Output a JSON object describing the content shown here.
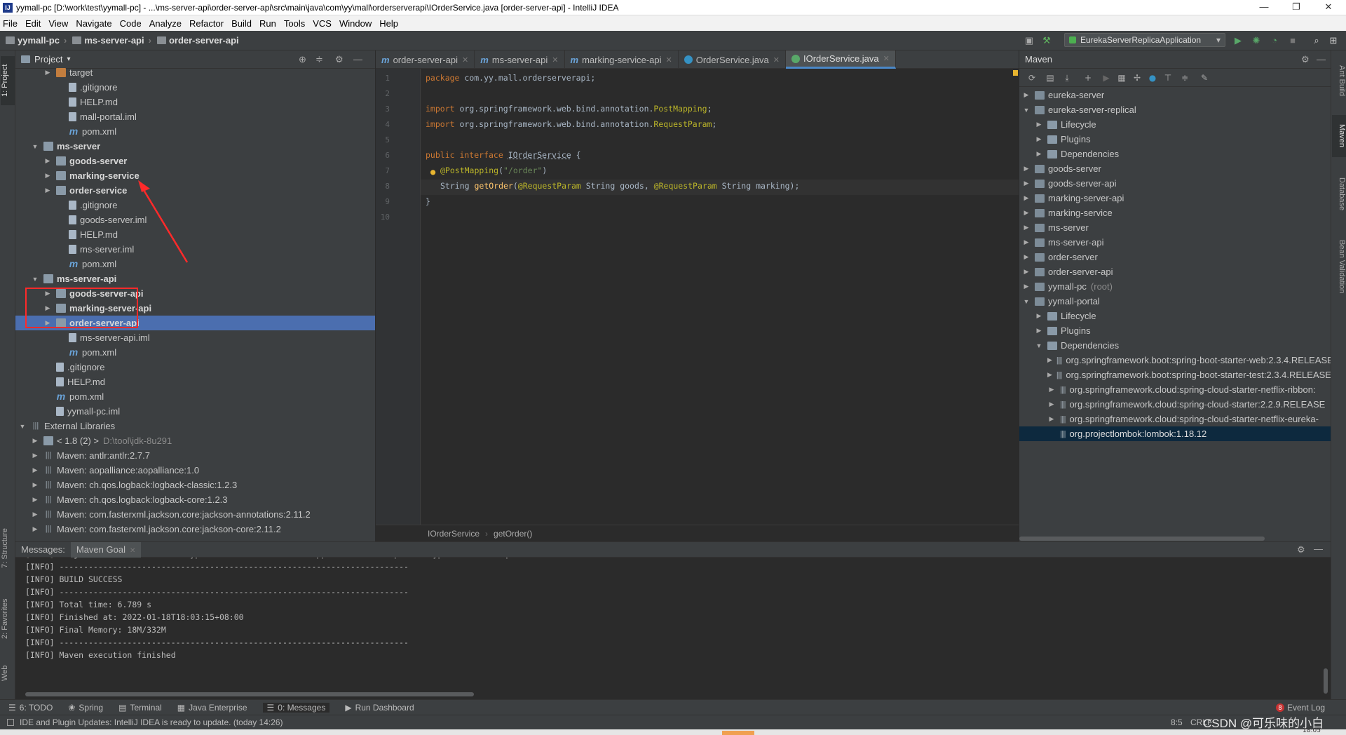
{
  "window": {
    "title": "yymall-pc [D:\\work\\test\\yymall-pc] - ...\\ms-server-api\\order-server-api\\src\\main\\java\\com\\yy\\mall\\orderserverapi\\IOrderService.java [order-server-api] - IntelliJ IDEA",
    "minimize": "—",
    "maximize": "❐",
    "close": "✕"
  },
  "menu": [
    "File",
    "Edit",
    "View",
    "Navigate",
    "Code",
    "Analyze",
    "Refactor",
    "Build",
    "Run",
    "Tools",
    "VCS",
    "Window",
    "Help"
  ],
  "breadcrumb": [
    "yymall-pc",
    "ms-server-api",
    "order-server-api"
  ],
  "run_config": "EurekaServerReplicaApplication",
  "left_strip": {
    "project": "1: Project",
    "structure": "7: Structure",
    "favorites": "2: Favorites",
    "web": "Web"
  },
  "right_strip": {
    "ant": "Ant Build",
    "maven": "Maven",
    "database": "Database",
    "bean": "Bean Validation"
  },
  "project_panel": {
    "title": "Project",
    "dropdown": "▾",
    "tree": [
      {
        "label": "target",
        "kind": "folder-orange",
        "depth": 2,
        "arrow": "▶"
      },
      {
        "label": ".gitignore",
        "kind": "file",
        "depth": 3,
        "arrow": ""
      },
      {
        "label": "HELP.md",
        "kind": "file",
        "depth": 3,
        "arrow": ""
      },
      {
        "label": "mall-portal.iml",
        "kind": "file",
        "depth": 3,
        "arrow": ""
      },
      {
        "label": "pom.xml",
        "kind": "xml",
        "depth": 3,
        "arrow": ""
      },
      {
        "label": "ms-server",
        "kind": "folder",
        "depth": 1,
        "arrow": "▼",
        "bold": true
      },
      {
        "label": "goods-server",
        "kind": "folder",
        "depth": 2,
        "arrow": "▶",
        "bold": true
      },
      {
        "label": "marking-service",
        "kind": "folder",
        "depth": 2,
        "arrow": "▶",
        "bold": true
      },
      {
        "label": "order-service",
        "kind": "folder",
        "depth": 2,
        "arrow": "▶",
        "bold": true
      },
      {
        "label": ".gitignore",
        "kind": "file",
        "depth": 3,
        "arrow": ""
      },
      {
        "label": "goods-server.iml",
        "kind": "file",
        "depth": 3,
        "arrow": ""
      },
      {
        "label": "HELP.md",
        "kind": "file",
        "depth": 3,
        "arrow": ""
      },
      {
        "label": "ms-server.iml",
        "kind": "file",
        "depth": 3,
        "arrow": ""
      },
      {
        "label": "pom.xml",
        "kind": "xml",
        "depth": 3,
        "arrow": ""
      },
      {
        "label": "ms-server-api",
        "kind": "folder",
        "depth": 1,
        "arrow": "▼",
        "bold": true
      },
      {
        "label": "goods-server-api",
        "kind": "folder",
        "depth": 2,
        "arrow": "▶",
        "bold": true
      },
      {
        "label": "marking-server-api",
        "kind": "folder",
        "depth": 2,
        "arrow": "▶",
        "bold": true
      },
      {
        "label": "order-server-api",
        "kind": "folder",
        "depth": 2,
        "arrow": "▶",
        "bold": true,
        "selected": true
      },
      {
        "label": "ms-server-api.iml",
        "kind": "file",
        "depth": 3,
        "arrow": ""
      },
      {
        "label": "pom.xml",
        "kind": "xml",
        "depth": 3,
        "arrow": ""
      },
      {
        "label": ".gitignore",
        "kind": "file",
        "depth": 2,
        "arrow": ""
      },
      {
        "label": "HELP.md",
        "kind": "file",
        "depth": 2,
        "arrow": ""
      },
      {
        "label": "pom.xml",
        "kind": "xml",
        "depth": 2,
        "arrow": ""
      },
      {
        "label": "yymall-pc.iml",
        "kind": "file",
        "depth": 2,
        "arrow": ""
      },
      {
        "label": "External Libraries",
        "kind": "lib",
        "depth": 0,
        "arrow": "▼"
      },
      {
        "label": "< 1.8 (2) >",
        "kind": "folder",
        "depth": 1,
        "arrow": "▶",
        "extra": "D:\\tool\\jdk-8u291"
      },
      {
        "label": "Maven: antlr:antlr:2.7.7",
        "kind": "lib",
        "depth": 1,
        "arrow": "▶"
      },
      {
        "label": "Maven: aopalliance:aopalliance:1.0",
        "kind": "lib",
        "depth": 1,
        "arrow": "▶"
      },
      {
        "label": "Maven: ch.qos.logback:logback-classic:1.2.3",
        "kind": "lib",
        "depth": 1,
        "arrow": "▶"
      },
      {
        "label": "Maven: ch.qos.logback:logback-core:1.2.3",
        "kind": "lib",
        "depth": 1,
        "arrow": "▶"
      },
      {
        "label": "Maven: com.fasterxml.jackson.core:jackson-annotations:2.11.2",
        "kind": "lib",
        "depth": 1,
        "arrow": "▶"
      },
      {
        "label": "Maven: com.fasterxml.jackson.core:jackson-core:2.11.2",
        "kind": "lib",
        "depth": 1,
        "arrow": "▶"
      }
    ]
  },
  "editor_tabs": [
    {
      "label": "order-server-api",
      "icon": "m"
    },
    {
      "label": "ms-server-api",
      "icon": "m"
    },
    {
      "label": "marking-service-api",
      "icon": "m"
    },
    {
      "label": "OrderService.java",
      "icon": "class"
    },
    {
      "label": "IOrderService.java",
      "icon": "interface",
      "active": true
    }
  ],
  "code": {
    "line_numbers": [
      "1",
      "2",
      "3",
      "4",
      "5",
      "6",
      "7",
      "8",
      "9",
      "10"
    ],
    "l1_kw": "package",
    "l1_rest": " com.yy.mall.orderserverapi;",
    "l3_kw": "import",
    "l3_pre": " org.springframework.web.bind.annotation.",
    "l3_ann": "PostMapping",
    "l3_end": ";",
    "l4_kw": "import",
    "l4_pre": " org.springframework.web.bind.annotation.",
    "l4_ann": "RequestParam",
    "l4_end": ";",
    "l6_kw": "public interface ",
    "l6_name": "IOrderService",
    "l6_end": " {",
    "l7_ann": "@PostMapping",
    "l7_p1": "(",
    "l7_str": "\"/order\"",
    "l7_p2": ")",
    "l8_t1": "String ",
    "l8_fn": "getOrder",
    "l8_a": "(",
    "l8_ann1": "@RequestParam",
    "l8_b": " String goods, ",
    "l8_ann2": "@RequestParam",
    "l8_c": " String marking);",
    "l9": "}"
  },
  "editor_breadcrumb": [
    "IOrderService",
    "getOrder()"
  ],
  "maven_panel": {
    "title": "Maven",
    "tree": [
      {
        "label": "eureka-server",
        "depth": 0,
        "arrow": "▶",
        "icon": "module"
      },
      {
        "label": "eureka-server-replical",
        "depth": 0,
        "arrow": "▼",
        "icon": "module"
      },
      {
        "label": "Lifecycle",
        "depth": 1,
        "arrow": "▶",
        "icon": "folder"
      },
      {
        "label": "Plugins",
        "depth": 1,
        "arrow": "▶",
        "icon": "folder"
      },
      {
        "label": "Dependencies",
        "depth": 1,
        "arrow": "▶",
        "icon": "folder"
      },
      {
        "label": "goods-server",
        "depth": 0,
        "arrow": "▶",
        "icon": "module"
      },
      {
        "label": "goods-server-api",
        "depth": 0,
        "arrow": "▶",
        "icon": "module"
      },
      {
        "label": "marking-server-api",
        "depth": 0,
        "arrow": "▶",
        "icon": "module"
      },
      {
        "label": "marking-service",
        "depth": 0,
        "arrow": "▶",
        "icon": "module"
      },
      {
        "label": "ms-server",
        "depth": 0,
        "arrow": "▶",
        "icon": "module"
      },
      {
        "label": "ms-server-api",
        "depth": 0,
        "arrow": "▶",
        "icon": "module"
      },
      {
        "label": "order-server",
        "depth": 0,
        "arrow": "▶",
        "icon": "module"
      },
      {
        "label": "order-server-api",
        "depth": 0,
        "arrow": "▶",
        "icon": "module"
      },
      {
        "label": "yymall-pc",
        "depth": 0,
        "arrow": "▶",
        "icon": "module",
        "extra": "(root)"
      },
      {
        "label": "yymall-portal",
        "depth": 0,
        "arrow": "▼",
        "icon": "module"
      },
      {
        "label": "Lifecycle",
        "depth": 1,
        "arrow": "▶",
        "icon": "folder"
      },
      {
        "label": "Plugins",
        "depth": 1,
        "arrow": "▶",
        "icon": "folder"
      },
      {
        "label": "Dependencies",
        "depth": 1,
        "arrow": "▼",
        "icon": "folder"
      },
      {
        "label": "org.springframework.boot:spring-boot-starter-web:2.3.4.RELEASE",
        "depth": 2,
        "arrow": "▶",
        "icon": "dep"
      },
      {
        "label": "org.springframework.boot:spring-boot-starter-test:2.3.4.RELEASE",
        "depth": 2,
        "arrow": "▶",
        "icon": "dep"
      },
      {
        "label": "org.springframework.cloud:spring-cloud-starter-netflix-ribbon:",
        "depth": 2,
        "arrow": "▶",
        "icon": "dep"
      },
      {
        "label": "org.springframework.cloud:spring-cloud-starter:2.2.9.RELEASE",
        "depth": 2,
        "arrow": "▶",
        "icon": "dep"
      },
      {
        "label": "org.springframework.cloud:spring-cloud-starter-netflix-eureka-",
        "depth": 2,
        "arrow": "▶",
        "icon": "dep"
      },
      {
        "label": "org.projectlombok:lombok:1.18.12",
        "depth": 2,
        "arrow": "",
        "icon": "dep",
        "selected": true
      }
    ]
  },
  "bottom_panel": {
    "tab_messages": "Messages:",
    "tab_goal": "Maven Goal",
    "lines": [
      "[INFO] Project created from Archetype in dir: C:\\Users\\...\\AppData\\Local\\Temp\\archetype\\ms-server-api",
      "[INFO] ------------------------------------------------------------------------",
      "[INFO] BUILD SUCCESS",
      "[INFO] ------------------------------------------------------------------------",
      "[INFO] Total time: 6.789 s",
      "[INFO] Finished at: 2022-01-18T18:03:15+08:00",
      "[INFO] Final Memory: 18M/332M",
      "[INFO] ------------------------------------------------------------------------",
      "[INFO] Maven execution finished"
    ]
  },
  "tool_windows": [
    {
      "label": "6: TODO",
      "icon": "☰"
    },
    {
      "label": "Spring",
      "icon": "❀"
    },
    {
      "label": "Terminal",
      "icon": "▤"
    },
    {
      "label": "Java Enterprise",
      "icon": "▦"
    },
    {
      "label": "0: Messages",
      "icon": "☰",
      "active": true
    },
    {
      "label": "Run Dashboard",
      "icon": "▶"
    }
  ],
  "event_log": {
    "count": "8",
    "label": "Event Log"
  },
  "status": {
    "message": "IDE and Plugin Updates: IntelliJ IDEA is ready to update. (today 14:26)",
    "position": "8:5",
    "encoding": "CRLF",
    "watermark": "CSDN @可乐味的小白",
    "clock": "18:05"
  },
  "colors": {
    "accent": "#4a88c7",
    "selection": "#4b6eaf",
    "annotation_box": "#ff2a2a"
  }
}
